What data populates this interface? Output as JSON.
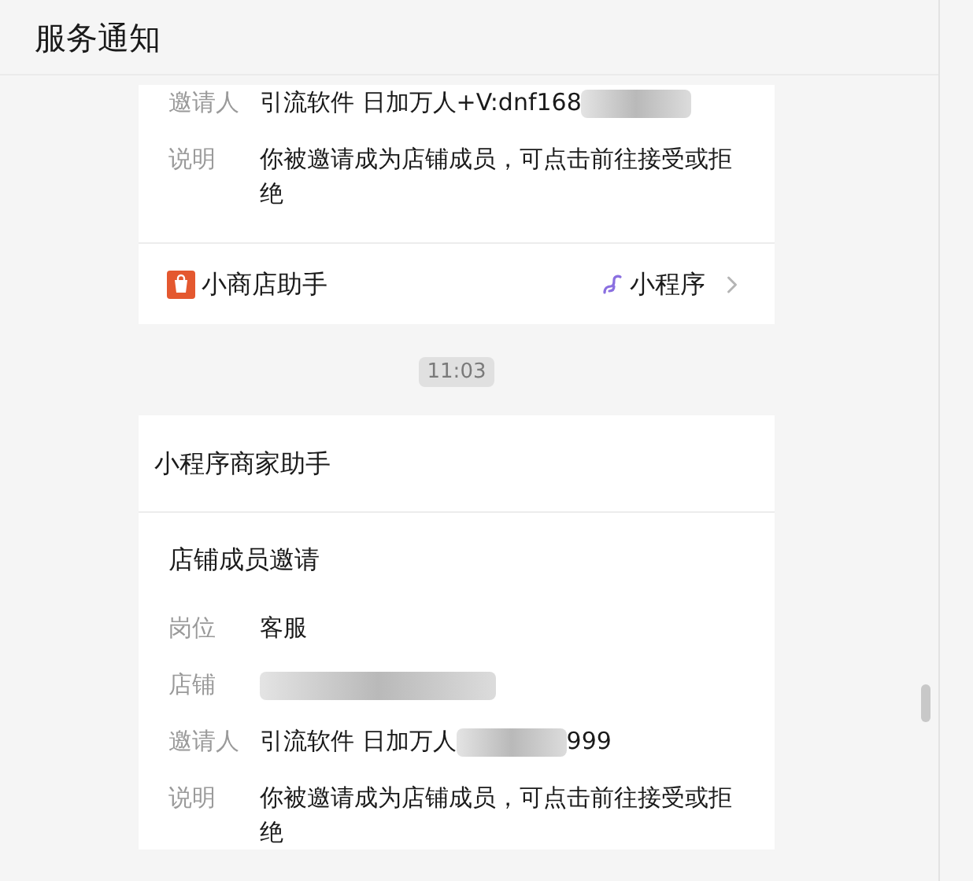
{
  "header": {
    "title": "服务通知"
  },
  "messages": [
    {
      "kind": "card",
      "fields": [
        {
          "label": "邀请人",
          "segments": [
            {
              "kind": "text",
              "text": "引流软件 日加万人+V:dnf168"
            },
            {
              "kind": "redacted"
            }
          ]
        },
        {
          "label": "说明",
          "segments": [
            {
              "kind": "text",
              "text": "你被邀请成为店铺成员，可点击前往接受或拒绝"
            }
          ]
        }
      ],
      "footer": {
        "app": "小商店助手",
        "type": "小程序"
      }
    },
    {
      "kind": "time",
      "time": "11:03"
    },
    {
      "kind": "card",
      "sender": "小程序商家助手",
      "title": "店铺成员邀请",
      "fields": [
        {
          "label": "岗位",
          "segments": [
            {
              "kind": "text",
              "text": "客服"
            }
          ]
        },
        {
          "label": "店铺",
          "segments": [
            {
              "kind": "redacted"
            }
          ]
        },
        {
          "label": "邀请人",
          "segments": [
            {
              "kind": "text",
              "text": "引流软件 日加万人"
            },
            {
              "kind": "redacted"
            },
            {
              "kind": "text",
              "text": "999"
            }
          ]
        },
        {
          "label": "说明",
          "segments": [
            {
              "kind": "text",
              "text": "你被邀请成为店铺成员，可点击前往接受或拒绝"
            }
          ]
        }
      ]
    }
  ]
}
